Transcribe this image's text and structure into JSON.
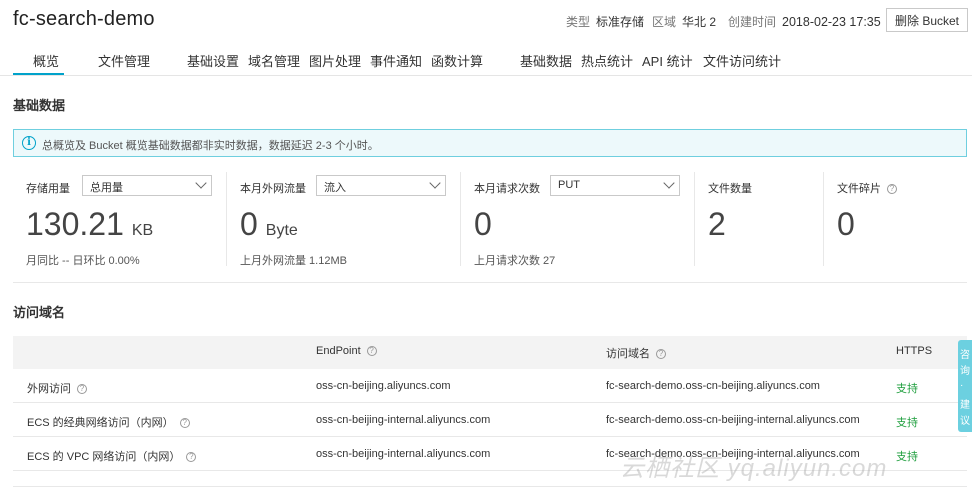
{
  "header": {
    "bucket_name": "fc-search-demo",
    "type_label": "类型",
    "type_value": "标准存储",
    "region_label": "区域",
    "region_value": "华北 2",
    "created_label": "创建时间",
    "created_value": "2018-02-23 17:35",
    "delete_button": "删除 Bucket"
  },
  "tabs": [
    {
      "label": "概览",
      "active": true
    },
    {
      "label": "文件管理"
    },
    {
      "label": "基础设置"
    },
    {
      "label": "域名管理"
    },
    {
      "label": "图片处理"
    },
    {
      "label": "事件通知"
    },
    {
      "label": "函数计算"
    },
    {
      "label": "基础数据"
    },
    {
      "label": "热点统计"
    },
    {
      "label": "API 统计"
    },
    {
      "label": "文件访问统计"
    }
  ],
  "basic": {
    "title": "基础数据",
    "info": "总概览及 Bucket 概览基础数据都非实时数据，数据延迟 2-3 个小时。",
    "stats": [
      {
        "label": "存储用量",
        "select": "总用量",
        "value": "130.21",
        "unit": "KB",
        "sub": "月同比 --  日环比 0.00%"
      },
      {
        "label": "本月外网流量",
        "select": "流入",
        "value": "0",
        "unit": "Byte",
        "sub": "上月外网流量 1.12MB"
      },
      {
        "label": "本月请求次数",
        "select": "PUT",
        "value": "0",
        "unit": "",
        "sub": "上月请求次数 27"
      },
      {
        "label": "文件数量",
        "value": "2"
      },
      {
        "label": "文件碎片",
        "value": "0"
      }
    ]
  },
  "domain": {
    "title": "访问域名",
    "headers": [
      "",
      "EndPoint",
      "访问域名",
      "HTTPS"
    ],
    "rows": [
      {
        "name": "外网访问",
        "endpoint": "oss-cn-beijing.aliyuncs.com",
        "domain": "fc-search-demo.oss-cn-beijing.aliyuncs.com",
        "https": "支持"
      },
      {
        "name": "ECS 的经典网络访问（内网）",
        "endpoint": "oss-cn-beijing-internal.aliyuncs.com",
        "domain": "fc-search-demo.oss-cn-beijing-internal.aliyuncs.com",
        "https": "支持"
      },
      {
        "name": "ECS 的 VPC 网络访问（内网）",
        "endpoint": "oss-cn-beijing-internal.aliyuncs.com",
        "domain": "fc-search-demo.oss-cn-beijing-internal.aliyuncs.com",
        "https": "支持"
      }
    ]
  },
  "side_float": [
    "咨",
    "询",
    "·",
    "建",
    "议"
  ],
  "watermark": "云栖社区 yq.aliyun.com"
}
